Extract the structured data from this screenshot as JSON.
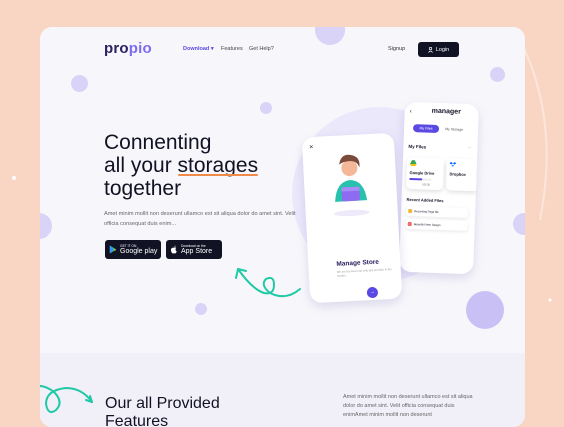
{
  "colors": {
    "page_bg": "#f9d6c4",
    "card_bg": "#f7f7fb",
    "accent": "#5a4ae3",
    "dark": "#121225",
    "underline": "#f08a4b",
    "teal": "#1fc9a6"
  },
  "nav": {
    "logo": "propio",
    "links": [
      {
        "label": "Download",
        "icon": "chevron-down-icon"
      },
      {
        "label": "Features"
      },
      {
        "label": "Get Help?"
      }
    ],
    "signup": "Signup",
    "login": "Login",
    "login_icon": "user-icon"
  },
  "hero": {
    "line1": "Connenting",
    "line2_a": "all your ",
    "line2_b": "storages",
    "line3": "together",
    "description": "Amet minim mollit non deserunt ullamco est sit aliqua dolor do amet sint. Velit officia consequat duis enim...",
    "google": {
      "small": "GET IT ON",
      "big": "Google play",
      "icon": "google-play-icon"
    },
    "apple": {
      "small": "Download on the",
      "big": "App Store",
      "icon": "apple-icon"
    }
  },
  "phone_front": {
    "title": "Manage Store",
    "subtitle": "We are the best and only app provider in the market",
    "close_icon": "close-icon",
    "fab_icon": "arrow-right-icon"
  },
  "phone_back": {
    "header": "manager",
    "back_icon": "chevron-left-icon",
    "tabs": [
      "My Files",
      "My Storage"
    ],
    "files_title": "My Files",
    "files_action": "...",
    "cards": [
      {
        "name": "Google Drive",
        "size": "62GB",
        "icon": "google-drive-icon"
      },
      {
        "name": "Dropbox",
        "size": "",
        "icon": "dropbox-icon"
      }
    ],
    "recent_title": "Recent Added Files",
    "recent": [
      {
        "name": "Recording Page.file",
        "icon": "file-icon"
      },
      {
        "name": "Beautiful New Design",
        "icon": "file-icon"
      }
    ]
  },
  "features": {
    "title_line1": "Our all Provided",
    "title_line2": "Features",
    "description": "Amet minim mollit non deserunt ullamco est sit aliqua dolor do amet sint. Velit officia consequat duis enimAmet minim mollit non deserunt"
  }
}
